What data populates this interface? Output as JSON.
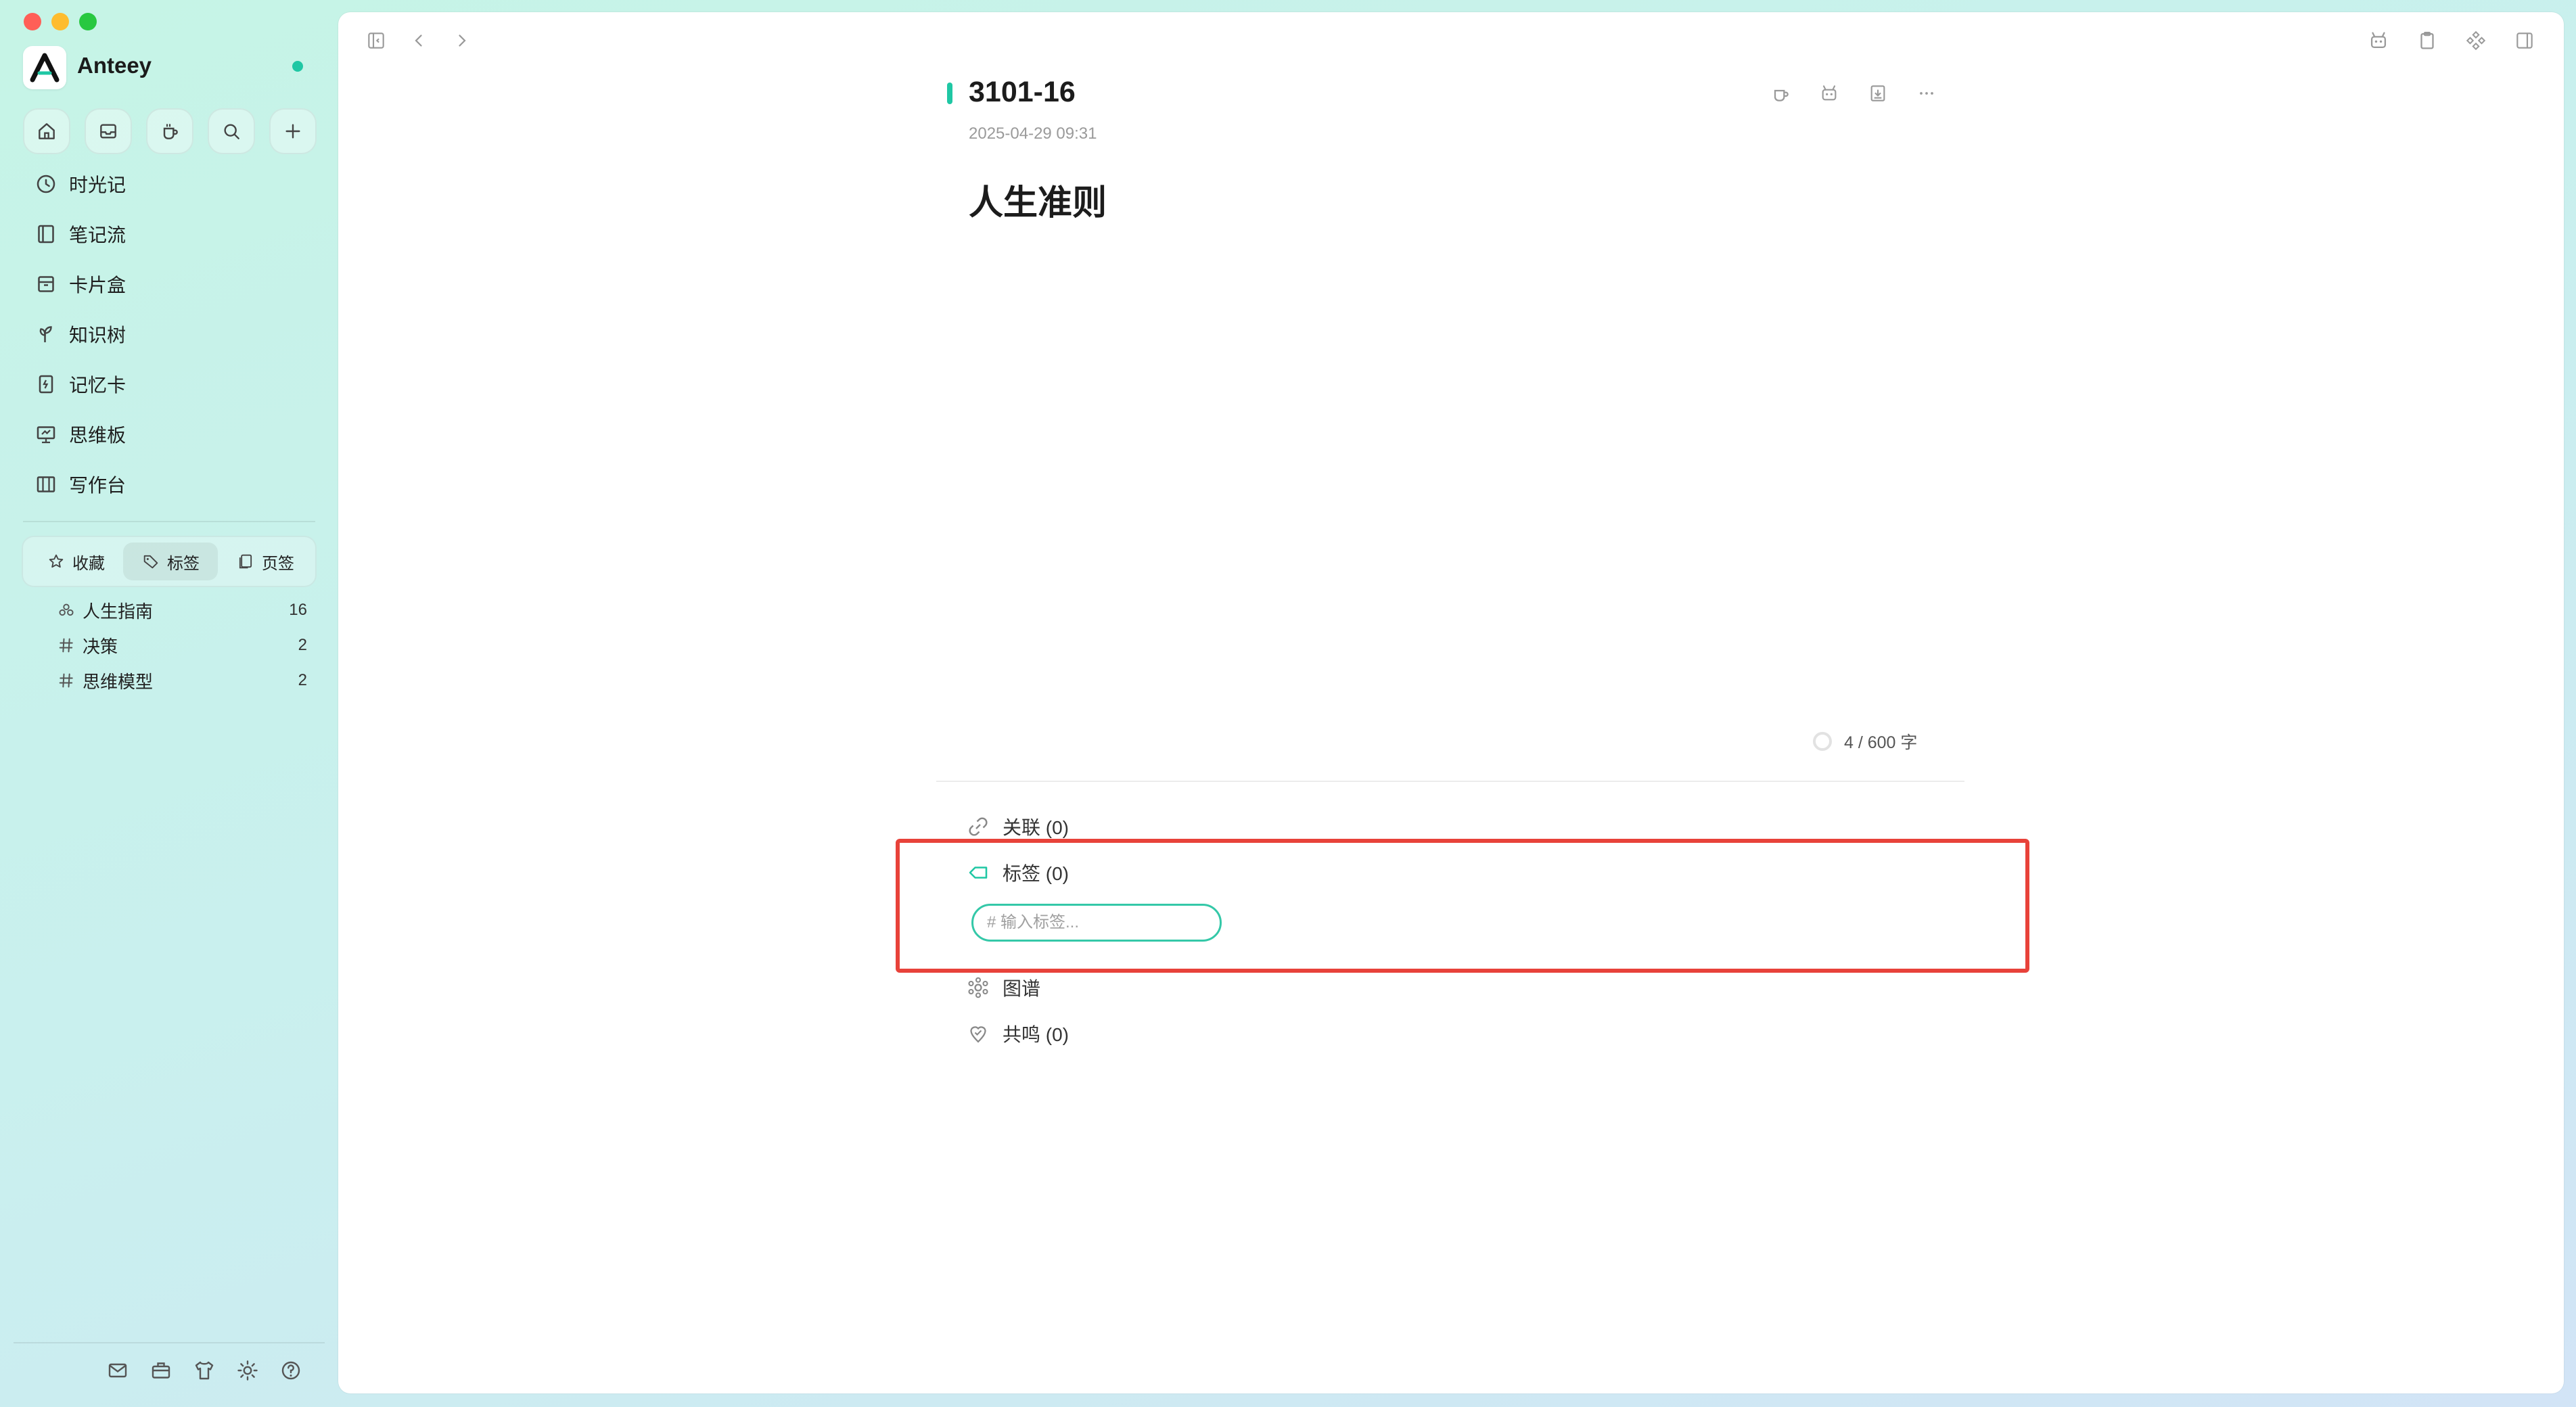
{
  "window": {
    "traffic_lights": {
      "close": "#ff5f57",
      "minimize": "#febc2e",
      "zoom": "#28c840"
    }
  },
  "brand": {
    "name": "Anteey",
    "accent": "#1fc7a4"
  },
  "quick_actions": [
    {
      "icon": "home-icon"
    },
    {
      "icon": "inbox-icon"
    },
    {
      "icon": "coffee-icon"
    },
    {
      "icon": "search-icon"
    },
    {
      "icon": "plus-icon"
    }
  ],
  "nav": [
    {
      "label": "时光记",
      "icon": "clock-icon"
    },
    {
      "label": "笔记流",
      "icon": "notebook-icon"
    },
    {
      "label": "卡片盒",
      "icon": "card-box-icon"
    },
    {
      "label": "知识树",
      "icon": "sprout-icon"
    },
    {
      "label": "记忆卡",
      "icon": "flashcard-icon"
    },
    {
      "label": "思维板",
      "icon": "whiteboard-icon"
    },
    {
      "label": "写作台",
      "icon": "writing-desk-icon"
    }
  ],
  "segmented": {
    "items": [
      {
        "label": "收藏",
        "icon": "star-icon"
      },
      {
        "label": "标签",
        "icon": "tag-icon",
        "active": true
      },
      {
        "label": "页签",
        "icon": "page-tab-icon"
      }
    ]
  },
  "tags": [
    {
      "label": "人生指南",
      "count": "16",
      "icon": "cluster-icon"
    },
    {
      "label": "决策",
      "count": "2",
      "icon": "hash-icon"
    },
    {
      "label": "思维模型",
      "count": "2",
      "icon": "hash-icon"
    }
  ],
  "sidebar_footer": [
    {
      "icon": "mail-icon"
    },
    {
      "icon": "toolbox-icon"
    },
    {
      "icon": "shirt-icon"
    },
    {
      "icon": "sun-icon"
    },
    {
      "icon": "help-icon"
    }
  ],
  "note": {
    "title": "3101-16",
    "date": "2025-04-29 09:31",
    "heading": "人生准则",
    "word_count": "4 / 600 字"
  },
  "sections": {
    "links_label": "关联 (0)",
    "tags_label": "标签 (0)",
    "tag_input_placeholder": "# 输入标签...",
    "graph_label": "图谱",
    "resonance_label": "共鸣 (0)"
  },
  "highlight_color": "#e8423a"
}
